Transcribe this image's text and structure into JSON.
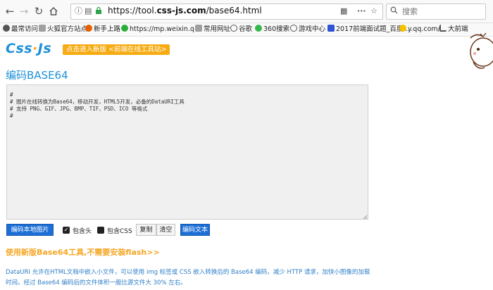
{
  "browser": {
    "url_prefix": "https://tool.",
    "url_host": "css-js.com",
    "url_path": "/base64.html",
    "search_placeholder": "搜索"
  },
  "bookmarks": [
    {
      "label": "最常访问",
      "icon": "gear-icon",
      "color": "#555555"
    },
    {
      "label": "火狐官方站点",
      "icon": "folder-icon",
      "color": "#8a8a8a"
    },
    {
      "label": "新手上路",
      "icon": "firefox-icon",
      "color": "#e66000"
    },
    {
      "label": "https://mp.weixin.q...",
      "icon": "wechat-icon",
      "color": "#2aae3a"
    },
    {
      "label": "常用网址",
      "icon": "folder-icon",
      "color": "#8a8a8a"
    },
    {
      "label": "谷歌",
      "icon": "globe-icon",
      "color": "#555555"
    },
    {
      "label": "360搜索",
      "icon": "360-icon",
      "color": "#36b94a"
    },
    {
      "label": "游戏中心",
      "icon": "globe-icon",
      "color": "#555555"
    },
    {
      "label": "2017前端面试题_百度...",
      "icon": "baidu-icon",
      "color": "#2f55d4"
    },
    {
      "label": "y.qq.com/",
      "icon": "qq-music-icon",
      "color": "#f5c100"
    },
    {
      "label": "大前端",
      "icon": "rss-icon",
      "color": "#555555"
    }
  ],
  "page": {
    "logo_left": "Css",
    "logo_dot": "·",
    "logo_right": "Js",
    "new_badge": "点击进入新版 <前端在线工具站>",
    "title": "编码BASE64",
    "editor_text": "#\n# 图片在线转换为Base64，移动开发，HTML5开发，必备的DataURI工具\n# 支持 PNG、GIF、JPG、BMP、TIF、PSD、ICO 等格式\n#",
    "encode_image_button": "编码本地图片",
    "include_header_label": "包含头",
    "include_css_label": "包含CSS",
    "copy_button": "复制",
    "clear_button": "清空",
    "encode_text_button": "编码文本",
    "flash_link": "使用新版Base64工具,不需要安装flash>>",
    "description": "DataURI 允许在HTML文档中嵌入小文件，可以使用 img 标签或 CSS 嵌入转换后的 Base64 编码，减少 HTTP 请求，加快小图像的加载时间。经过 Base64 编码后的文件体积一般比源文件大 30% 左右。"
  },
  "colors": {
    "accent": "#1e90d8",
    "badge": "#f6ab12",
    "primary_button": "#1d6fd6"
  }
}
